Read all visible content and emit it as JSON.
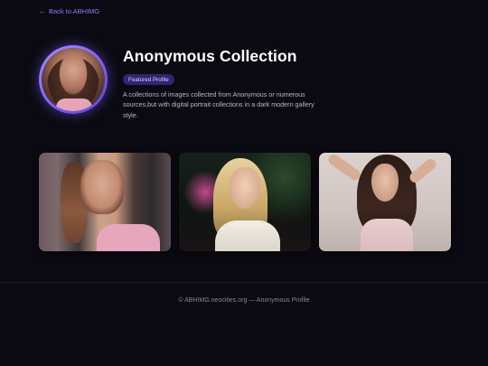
{
  "nav": {
    "back_arrow": "←",
    "back_label": "Back to ABHIMG"
  },
  "profile": {
    "title": "Anonymous Collection",
    "badge": "Featured Profile",
    "description": "A collections of images collected from Anonymous or numerous sources,but with digital portrait collections in a dark modern gallery style."
  },
  "gallery": {
    "items": [
      {
        "name": "photo-1"
      },
      {
        "name": "photo-2"
      },
      {
        "name": "photo-3"
      }
    ]
  },
  "footer": {
    "text": "© ABHIMG.neocities.org — Anonymous Profile"
  },
  "colors": {
    "background": "#0b0a12",
    "accent": "#7b5cff",
    "badge_bg": "#2f2670"
  }
}
